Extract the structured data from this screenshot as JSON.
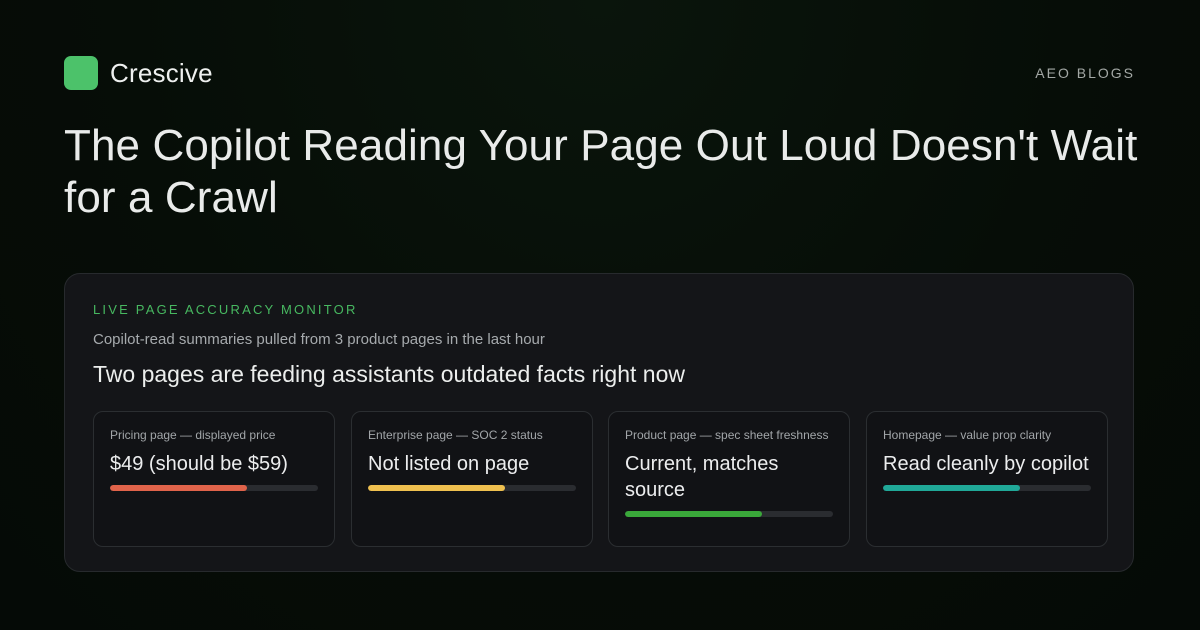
{
  "brand": {
    "name": "Crescive",
    "logo_color": "#4cc26a"
  },
  "section_tag": "AEO BLOGS",
  "headline": "The Copilot Reading Your Page Out Loud Doesn't Wait for a Crawl",
  "monitor": {
    "eyebrow": "LIVE PAGE ACCURACY MONITOR",
    "subtitle": "Copilot-read summaries pulled from 3 product pages in the last hour",
    "title": "Two pages are feeding assistants outdated facts right now",
    "metrics": [
      {
        "label": "Pricing page — displayed price",
        "value": "$49 (should be $59)",
        "fill_color": "#e0634a",
        "fill_fraction": 0.66
      },
      {
        "label": "Enterprise page — SOC 2 status",
        "value": "Not listed on page",
        "fill_color": "#efc04f",
        "fill_fraction": 0.66
      },
      {
        "label": "Product page — spec sheet freshness",
        "value": "Current, matches source",
        "fill_color": "#3aa83a",
        "fill_fraction": 0.66
      },
      {
        "label": "Homepage — value prop clarity",
        "value": "Read cleanly by copilot",
        "fill_color": "#20a898",
        "fill_fraction": 0.66
      }
    ]
  }
}
